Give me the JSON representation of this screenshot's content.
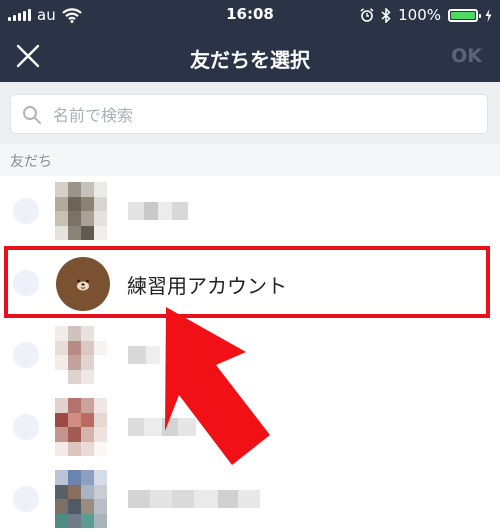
{
  "status": {
    "carrier": "au",
    "time": "16:08",
    "battery_percent_label": "100%",
    "battery_level": 1.0
  },
  "navbar": {
    "title": "友だちを選択",
    "ok_label": "OK"
  },
  "search": {
    "placeholder": "名前で検索"
  },
  "friends": {
    "section_label": "友だち",
    "items": [
      {
        "name": ""
      },
      {
        "name": "練習用アカウント"
      },
      {
        "name": ""
      },
      {
        "name": ""
      },
      {
        "name": ""
      }
    ]
  },
  "icons": [
    "close-icon",
    "search-icon",
    "wifi-icon",
    "alarm-icon",
    "bluetooth-icon",
    "battery-icon",
    "charging-icon"
  ],
  "colors": {
    "header_bg": "#2b3446",
    "highlight_border": "#e8101a",
    "arrow": "#f01015",
    "battery_fill": "#4cd964"
  }
}
